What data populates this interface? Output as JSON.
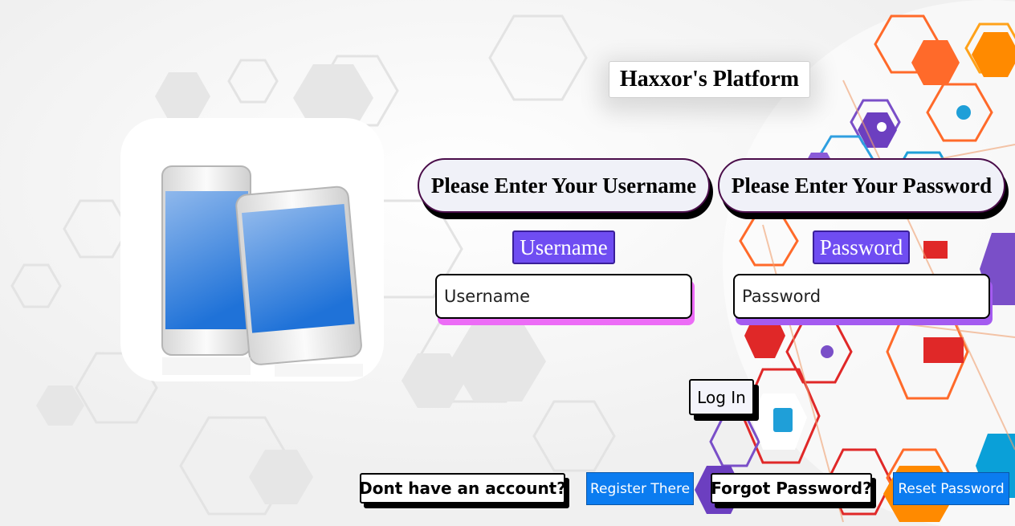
{
  "header": {
    "title": "Haxxor's Platform"
  },
  "username": {
    "prompt": "Please Enter Your Username",
    "label": "Username",
    "placeholder": "Username"
  },
  "password": {
    "prompt": "Please Enter Your Password",
    "label": "Password",
    "placeholder": "Password"
  },
  "actions": {
    "login_label": "Log In",
    "account_question": "Dont have an account?",
    "register_label": "Register There",
    "forgot_question": "Forgot Password?",
    "reset_label": "Reset Password"
  },
  "icons": {
    "illustration": "smartphones-illustration",
    "background": "hexagon-network-globe-background"
  },
  "colors": {
    "label_purple": "#6f4df2",
    "button_blue": "#0b7cf0",
    "pill_border": "#4a0d4a",
    "username_shadow": "#ec6cf6",
    "password_shadow": "#a45bf0"
  }
}
